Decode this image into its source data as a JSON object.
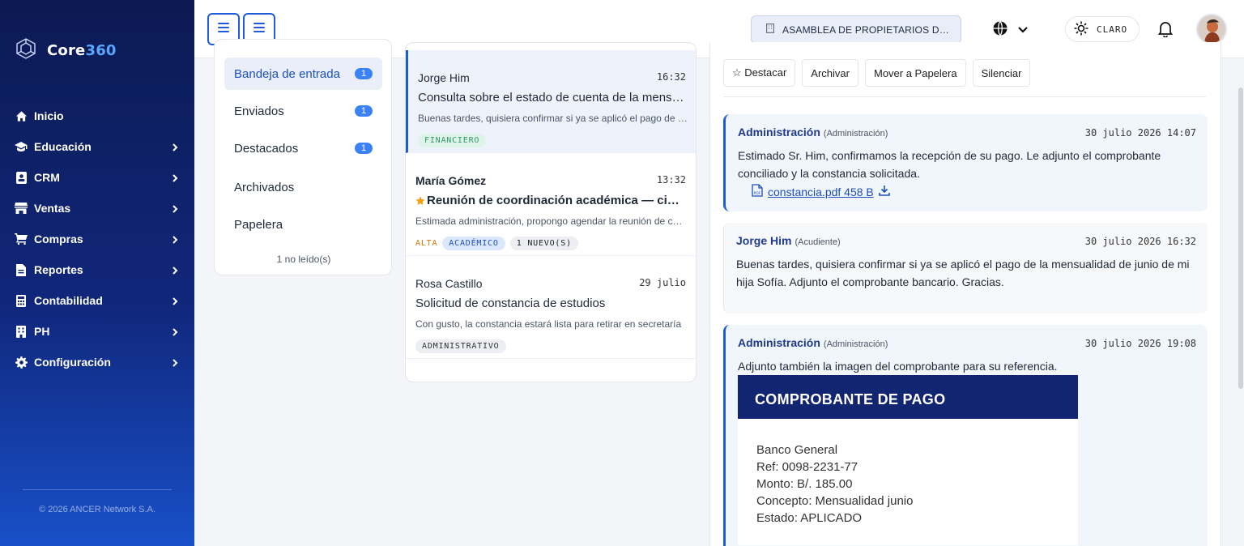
{
  "brand": {
    "name_part1": "Core",
    "name_part2": "360"
  },
  "sidebar": {
    "items": [
      {
        "label": "Inicio",
        "icon": "home-icon",
        "has_children": false
      },
      {
        "label": "Educación",
        "icon": "graduation-cap-icon",
        "has_children": true
      },
      {
        "label": "CRM",
        "icon": "contact-card-icon",
        "has_children": true
      },
      {
        "label": "Ventas",
        "icon": "store-icon",
        "has_children": true
      },
      {
        "label": "Compras",
        "icon": "cart-icon",
        "has_children": true
      },
      {
        "label": "Reportes",
        "icon": "report-icon",
        "has_children": true
      },
      {
        "label": "Contabilidad",
        "icon": "calculator-icon",
        "has_children": true
      },
      {
        "label": "PH",
        "icon": "building-icon",
        "has_children": true
      },
      {
        "label": "Configuración",
        "icon": "gear-icon",
        "has_children": true
      }
    ],
    "footer": "© 2026 ANCER Network S.A."
  },
  "topbar": {
    "org_selector": "ASAMBLEA DE PROPIETARIOS DE ...",
    "theme_label": "CLARO"
  },
  "folders": {
    "items": [
      {
        "label": "Bandeja de entrada",
        "count": "1",
        "active": true
      },
      {
        "label": "Enviados",
        "count": "1",
        "active": false
      },
      {
        "label": "Destacados",
        "count": "1",
        "active": false
      },
      {
        "label": "Archivados",
        "count": "",
        "active": false
      },
      {
        "label": "Papelera",
        "count": "",
        "active": false
      }
    ],
    "unread_text": "1 no leído(s)"
  },
  "messages": [
    {
      "from": "Jorge Him",
      "time": "16:32",
      "subject": "Consulta sobre el estado de cuenta de la mensualidad",
      "preview": "Buenas tardes, quisiera confirmar si ya se aplicó el pago de la mensualidad",
      "tags": [
        "FINANCIERO"
      ],
      "selected": true
    },
    {
      "from": "María Gómez",
      "time": "13:32",
      "subject": "Reunión de coordinación académica — cierre de trimestre",
      "preview": "Estimada administración, propongo agendar la reunión de coordinación",
      "priority": "ALTA",
      "tags": [
        "ACADÉMICO",
        "1 NUEVO(S)"
      ],
      "starred": true
    },
    {
      "from": "Rosa Castillo",
      "time": "29 julio",
      "subject": "Solicitud de constancia de estudios",
      "preview": "Con gusto, la constancia estará lista para retirar en secretaría",
      "tags": [
        "ADMINISTRATIVO"
      ]
    }
  ],
  "reader": {
    "actions": [
      "☆ Destacar",
      "Archivar",
      "Mover a Papelera",
      "Silenciar"
    ],
    "thread": [
      {
        "who": "Administración",
        "role": "(Administración)",
        "date": "30 julio 2026 14:07",
        "body": "Estimado Sr. Him, confirmamos la recepción de su pago. Le adjunto el comprobante conciliado y la constancia solicitada.",
        "attachment": "constancia.pdf 458 B"
      },
      {
        "who": "Jorge Him",
        "role": "(Acudiente)",
        "date": "30 julio 2026 16:32",
        "body": "Buenas tardes, quisiera confirmar si ya se aplicó el pago de la mensualidad de junio de mi hija Sofía. Adjunto el comprobante bancario. Gracias."
      },
      {
        "who": "Administración",
        "role": "(Administración)",
        "date": "30 julio 2026 19:08",
        "body": "Adjunto también la imagen del comprobante para su referencia.",
        "receipt": {
          "title": "COMPROBANTE DE PAGO",
          "lines": [
            "Banco General",
            "Ref: 0098-2231-77",
            "Monto: B/. 185.00",
            "Concepto: Mensualidad junio",
            "Estado: APLICADO"
          ]
        }
      }
    ]
  },
  "colors": {
    "accent": "#1d5bd8",
    "sidebar_top": "#0c1a52",
    "sidebar_bottom": "#1850c9",
    "badge": "#3b82f6"
  }
}
